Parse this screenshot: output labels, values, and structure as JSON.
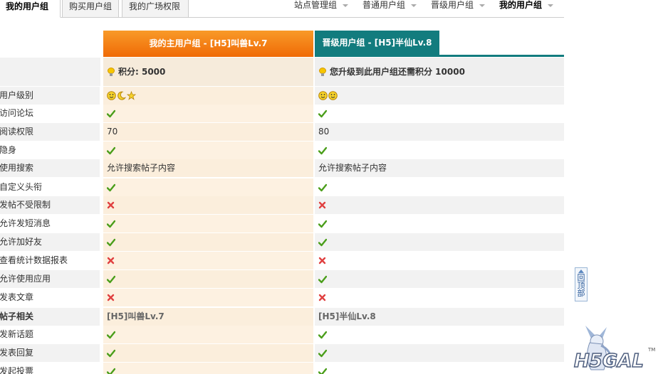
{
  "tabs": {
    "left": [
      "我的用户组",
      "购买用户组",
      "我的广场权限"
    ],
    "right": [
      "站点管理组",
      "普通用户组",
      "晋级用户组",
      "我的用户组"
    ]
  },
  "columns": {
    "main": "我的主用户组 - [H5]叫兽Lv.7",
    "next": "晋级用户组 - [H5]半仙Lv.8"
  },
  "summary": {
    "main": "积分: 5000",
    "next": "您升级到此用户组还需积分 10000"
  },
  "rows": [
    {
      "label": "用户级别",
      "main": "badges3",
      "next": "badges2"
    },
    {
      "label": "访问论坛",
      "main": "yes",
      "next": "yes"
    },
    {
      "label": "阅读权限",
      "main": "70",
      "next": "80"
    },
    {
      "label": "隐身",
      "main": "yes",
      "next": "yes"
    },
    {
      "label": "使用搜索",
      "main": "允许搜索帖子内容",
      "next": "允许搜索帖子内容"
    },
    {
      "label": "自定义头衔",
      "main": "yes",
      "next": "yes"
    },
    {
      "label": "发帖不受限制",
      "main": "no",
      "next": "no"
    },
    {
      "label": "允许发短消息",
      "main": "yes",
      "next": "yes"
    },
    {
      "label": "允许加好友",
      "main": "yes",
      "next": "yes"
    },
    {
      "label": "查看统计数据报表",
      "main": "no",
      "next": "no"
    },
    {
      "label": "允许使用应用",
      "main": "yes",
      "next": "yes"
    },
    {
      "label": "发表文章",
      "main": "no",
      "next": "no"
    },
    {
      "label": "帖子相关",
      "main": "[H5]叫兽Lv.7",
      "next": "[H5]半仙Lv.8",
      "section": true
    },
    {
      "label": "发新话题",
      "main": "yes",
      "next": "yes"
    },
    {
      "label": "发表回复",
      "main": "yes",
      "next": "yes"
    },
    {
      "label": "发起投票",
      "main": "yes",
      "next": "yes"
    }
  ],
  "backtop": "回顶部",
  "logo": {
    "text": "H5GAL",
    "tm": "TM"
  },
  "colors": {
    "orange": "#f37a12",
    "teal": "#127c7e",
    "check": "#4a9e1a",
    "cross": "#e04040"
  }
}
